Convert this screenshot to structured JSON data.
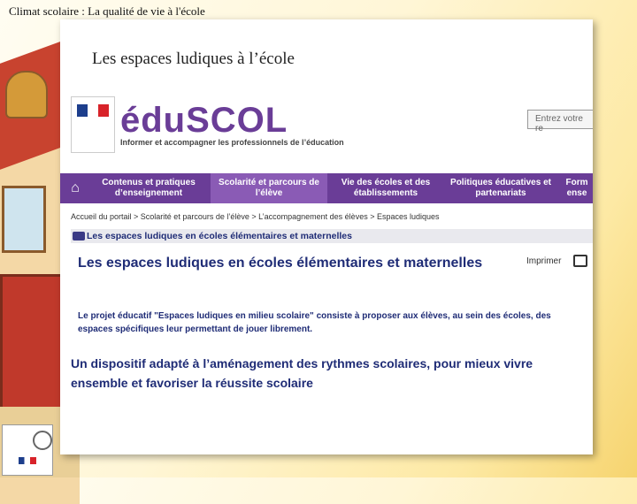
{
  "slide": {
    "title": "Climat scolaire : La qualité de vie à l'école"
  },
  "panel": {
    "title": "Les espaces ludiques à l’école"
  },
  "site": {
    "brand": "éduSCOL",
    "tagline": "Informer et accompagner les professionnels de l’éducation",
    "search_placeholder": "Entrez votre re",
    "nav": [
      {
        "label": "Contenus et pratiques d’enseignement",
        "active": false
      },
      {
        "label": "Scolarité et parcours de l’élève",
        "active": true
      },
      {
        "label": "Vie des écoles et des établissements",
        "active": false
      },
      {
        "label": "Politiques éducatives et partenariats",
        "active": false
      },
      {
        "label": "Form ense",
        "active": false
      }
    ],
    "breadcrumb": "Accueil du portail > Scolarité et parcours de l’élève > L’accompagnement des élèves > Espaces ludiques",
    "section": "Les espaces ludiques en écoles élémentaires et maternelles",
    "heading": "Les espaces ludiques en écoles élémentaires et maternelles",
    "print_label": "Imprimer",
    "intro": "Le projet éducatif \"Espaces ludiques en milieu scolaire\" consiste à proposer aux élèves, au sein des écoles, des espaces spécifiques leur permettant de jouer librement.",
    "subtitle": "Un dispositif adapté à l’aménagement des rythmes scolaires, pour mieux vivre ensemble et favoriser la réussite scolaire"
  },
  "colors": {
    "purple": "#6a3d97",
    "navy": "#1f2c76"
  }
}
